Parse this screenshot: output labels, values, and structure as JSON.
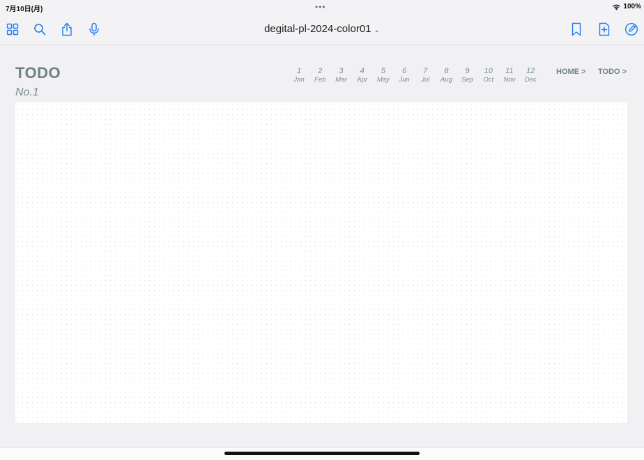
{
  "status_bar": {
    "time": "7月10日(月)",
    "dots": "•••",
    "battery": "100%",
    "wifi_icon": "wifi-icon"
  },
  "toolbar": {
    "document_title": "degital-pl-2024-color01",
    "title_chevron": "⌄",
    "left_icons": [
      "thumbnails-grid-icon",
      "search-icon",
      "share-icon",
      "microphone-icon"
    ],
    "right_icons": [
      "bookmark-icon",
      "add-page-icon",
      "pen-edit-icon"
    ],
    "accent_color": "#1a7cf5"
  },
  "page": {
    "heading": "TODO",
    "subheading": "No.1",
    "months": [
      {
        "num": "1",
        "name": "Jan"
      },
      {
        "num": "2",
        "name": "Feb"
      },
      {
        "num": "3",
        "name": "Mar"
      },
      {
        "num": "4",
        "name": "Apr"
      },
      {
        "num": "5",
        "name": "May"
      },
      {
        "num": "6",
        "name": "Jun"
      },
      {
        "num": "7",
        "name": "Jul"
      },
      {
        "num": "8",
        "name": "Aug"
      },
      {
        "num": "9",
        "name": "Sep"
      },
      {
        "num": "10",
        "name": "Oct"
      },
      {
        "num": "11",
        "name": "Nov"
      },
      {
        "num": "12",
        "name": "Dec"
      }
    ],
    "nav": {
      "home": "HOME >",
      "todo": "TODO >"
    },
    "text_color": "#6f8384"
  }
}
